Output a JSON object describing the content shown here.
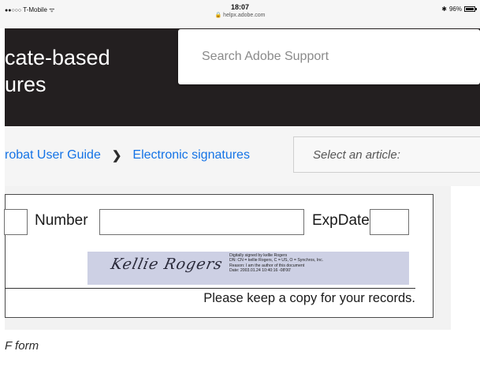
{
  "status_bar": {
    "carrier": "T-Mobile",
    "signal_dots": "●●○○○",
    "wifi_glyph": "ᯤ",
    "time": "18:07",
    "url": "helpx.adobe.com",
    "bluetooth_glyph": "✱",
    "battery": "96%"
  },
  "header": {
    "title": "cate-based\nures",
    "search": {
      "placeholder": "Search Adobe Support",
      "value": ""
    }
  },
  "breadcrumb": {
    "items": [
      {
        "label": "robat User Guide"
      },
      {
        "label": "Electronic signatures"
      }
    ],
    "separator": "❯",
    "article_select": "Select an article:"
  },
  "figure": {
    "form": {
      "number_label": "Number",
      "expdate_label": "ExpDate",
      "signature_script": "Kellie Rogers",
      "signature_details": [
        "Digitally signed by kellie Rogers",
        "DN: CN = kellie Rogers, C = US, O = Synchros, Inc.",
        "Reason: I am the author of this document",
        "Date: 2003.01.24 10:40:16 -08'00'"
      ],
      "footer_note": "Please keep a copy for your records."
    },
    "caption": "F form"
  }
}
